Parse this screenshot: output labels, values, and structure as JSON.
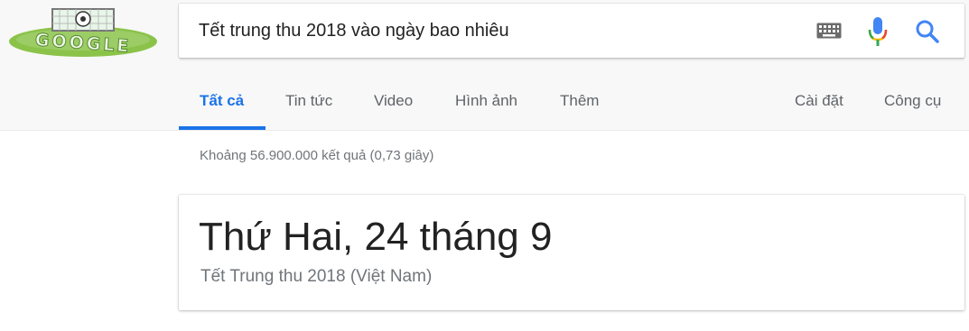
{
  "logo": {
    "text": "GOOGLE",
    "alt": "Google Doodle"
  },
  "search": {
    "query": "Tết trung thu 2018 vào ngày bao nhiêu"
  },
  "tabs": [
    {
      "label": "Tất cả",
      "active": true
    },
    {
      "label": "Tin tức"
    },
    {
      "label": "Video"
    },
    {
      "label": "Hình ảnh"
    },
    {
      "label": "Thêm"
    }
  ],
  "tools": {
    "settings_label": "Cài đặt",
    "tools_label": "Công cụ"
  },
  "result_stats": "Khoảng 56.900.000 kết quả (0,73 giây)",
  "answer_card": {
    "answer": "Thứ Hai, 24 tháng 9",
    "subtitle": "Tết Trung thu 2018 (Việt Nam)"
  },
  "colors": {
    "accent": "#1a73e8",
    "mic_blue": "#4285f4",
    "mic_red": "#ea4335",
    "mic_yellow": "#fbbc05",
    "mic_green": "#34a853"
  },
  "icons": [
    "keyboard-icon",
    "microphone-icon",
    "search-icon"
  ]
}
